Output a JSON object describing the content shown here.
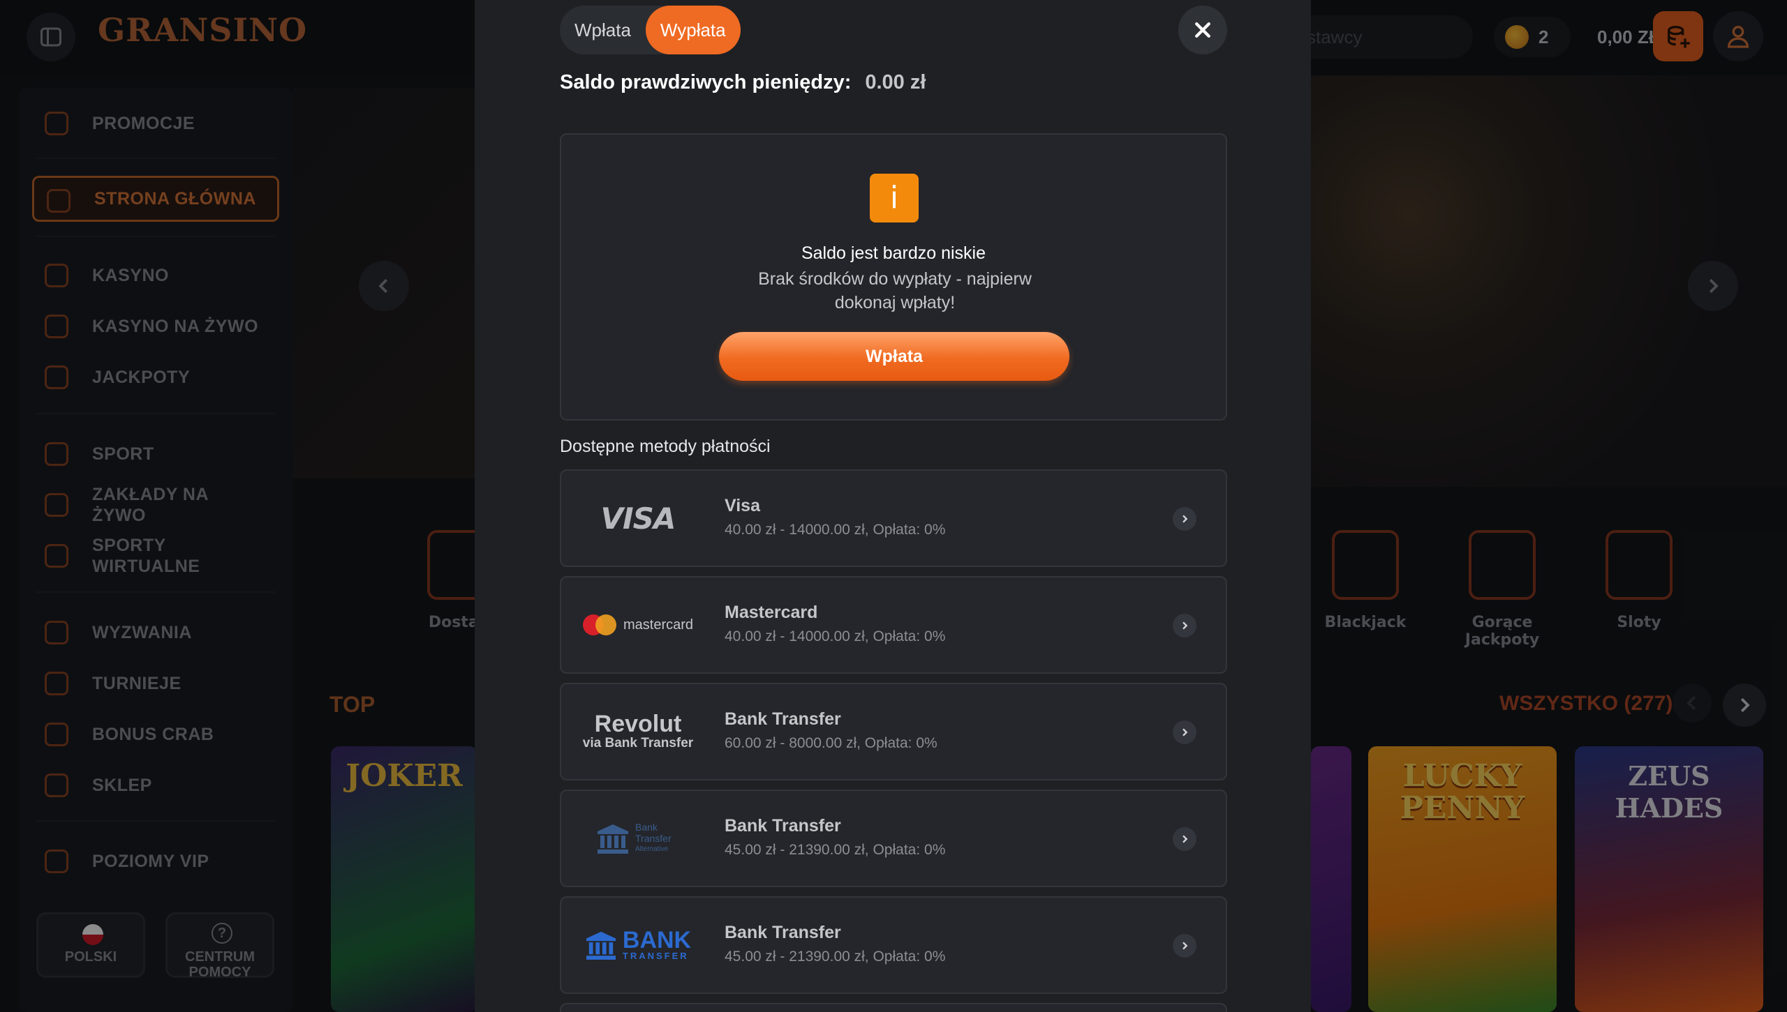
{
  "site": {
    "logo": "GRANSINO",
    "search_placeholder": "stawcy",
    "coins": "2",
    "balance": "0,00 ZŁ",
    "sidebar": {
      "items": [
        {
          "label": "PROMOCJE"
        },
        {
          "label": "STRONA GŁÓWNA"
        },
        {
          "label": "KASYNO"
        },
        {
          "label": "KASYNO NA ŻYWO"
        },
        {
          "label": "JACKPOTY"
        },
        {
          "label": "SPORT"
        },
        {
          "label": "ZAKŁADY NA ŻYWO"
        },
        {
          "label": "SPORTY WIRTUALNE"
        },
        {
          "label": "WYZWANIA"
        },
        {
          "label": "TURNIEJE"
        },
        {
          "label": "BONUS CRAB"
        },
        {
          "label": "SKLEP"
        },
        {
          "label": "POZIOMY VIP"
        }
      ],
      "language": "POLSKI",
      "help": "CENTRUM POMOCY"
    },
    "categories": [
      {
        "label": "Dostaw"
      },
      {
        "label": "Blackjack"
      },
      {
        "label": "Gorące Jackpoty"
      },
      {
        "label": "Sloty"
      }
    ],
    "top_title": "TOP",
    "all_link": "WSZYSTKO (277)",
    "games": [
      {
        "title": "JOKER"
      },
      {
        "title": "LUCKY PENNY"
      },
      {
        "title": "ZEUS HADES"
      }
    ]
  },
  "modal": {
    "tabs": [
      {
        "label": "Wpłata"
      },
      {
        "label": "Wypłata"
      }
    ],
    "saldo_label": "Saldo prawdziwych pieniędzy:",
    "saldo_value": "0.00 zł",
    "info": {
      "icon": "i",
      "title": "Saldo jest bardzo niskie",
      "text": "Brak środków do wypłaty - najpierw dokonaj wpłaty!",
      "button": "Wpłata"
    },
    "methods_label": "Dostępne metody płatności",
    "methods": [
      {
        "logo": "VISA",
        "name": "Visa",
        "range": "40.00 zł - 14000.00 zł, Opłata: 0%"
      },
      {
        "logo": "mastercard",
        "name": "Mastercard",
        "range": "40.00 zł - 14000.00 zł, Opłata: 0%"
      },
      {
        "logo": "Revolut",
        "logo_sub": "via Bank Transfer",
        "name": "Bank Transfer",
        "range": "60.00 zł - 8000.00 zł, Opłata: 0%"
      },
      {
        "logo": "Bank Transfer",
        "logo_sub": "Alternative",
        "name": "Bank Transfer",
        "range": "45.00 zł - 21390.00 zł, Opłata: 0%"
      },
      {
        "logo": "BANK",
        "logo_sub": "TRANSFER",
        "name": "Bank Transfer",
        "range": "45.00 zł - 21390.00 zł, Opłata: 0%"
      }
    ]
  },
  "colors": {
    "accent": "#ef6a22",
    "info_icon": "#f48a0c",
    "modal_bg": "#1e2024"
  }
}
